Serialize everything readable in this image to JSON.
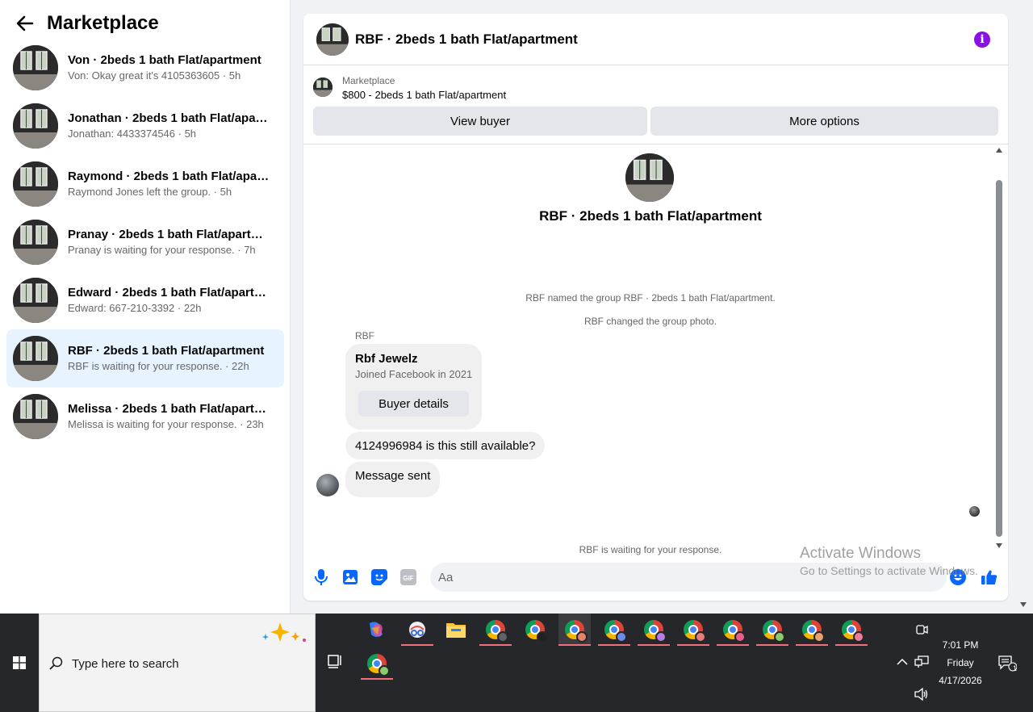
{
  "sidebar": {
    "title": "Marketplace",
    "conversations": [
      {
        "name": "Von · 2beds 1 bath Flat/apartment",
        "subtitle": "Von: Okay great it's 4105363605 · 5h"
      },
      {
        "name": "Jonathan · 2beds 1 bath Flat/apart...",
        "subtitle": "Jonathan: 4433374546 · 5h"
      },
      {
        "name": "Raymond · 2beds 1 bath Flat/apart...",
        "subtitle": "Raymond Jones left the group. · 5h"
      },
      {
        "name": "Pranay · 2beds 1 bath Flat/apartm...",
        "subtitle": "Pranay is waiting for your response. · 7h"
      },
      {
        "name": "Edward · 2beds 1 bath Flat/apartm...",
        "subtitle": "Edward: 667-210-3392 · 22h"
      },
      {
        "name": "RBF · 2beds 1 bath Flat/apartment",
        "subtitle": "RBF is waiting for your response. · 22h"
      },
      {
        "name": "Melissa · 2beds 1 bath Flat/apartm...",
        "subtitle": "Melissa is waiting for your response. · 23h"
      }
    ]
  },
  "chat": {
    "title": "RBF · 2beds 1 bath Flat/apartment",
    "listing_label": "Marketplace",
    "listing_price": "$800 - 2beds 1 bath Flat/apartment",
    "view_buyer": "View buyer",
    "more_options": "More options",
    "group_name": "RBF · 2beds 1 bath Flat/apartment",
    "system_1": "RBF named the group RBF · 2beds 1 bath Flat/apartment.",
    "system_2": "RBF changed the group photo.",
    "sender": "RBF",
    "card_name": "Rbf Jewelz",
    "card_sub": "Joined Facebook in 2021",
    "card_button": "Buyer details",
    "message_1": "4124996984 is this still available?",
    "message_2": "Message sent",
    "waiting": "RBF is waiting for your response.",
    "input_placeholder": "Aa"
  },
  "watermark": {
    "title": "Activate Windows",
    "subtitle": "Go to Settings to activate Windows."
  },
  "taskbar": {
    "search_placeholder": "Type here to search",
    "time": "7:01 PM",
    "day": "Friday",
    "date": "4/17/2026",
    "notification_count": "1"
  },
  "colors": {
    "accent": "#0866ff",
    "active_row": "#e7f3ff",
    "info_purple": "#8a0ee6"
  }
}
